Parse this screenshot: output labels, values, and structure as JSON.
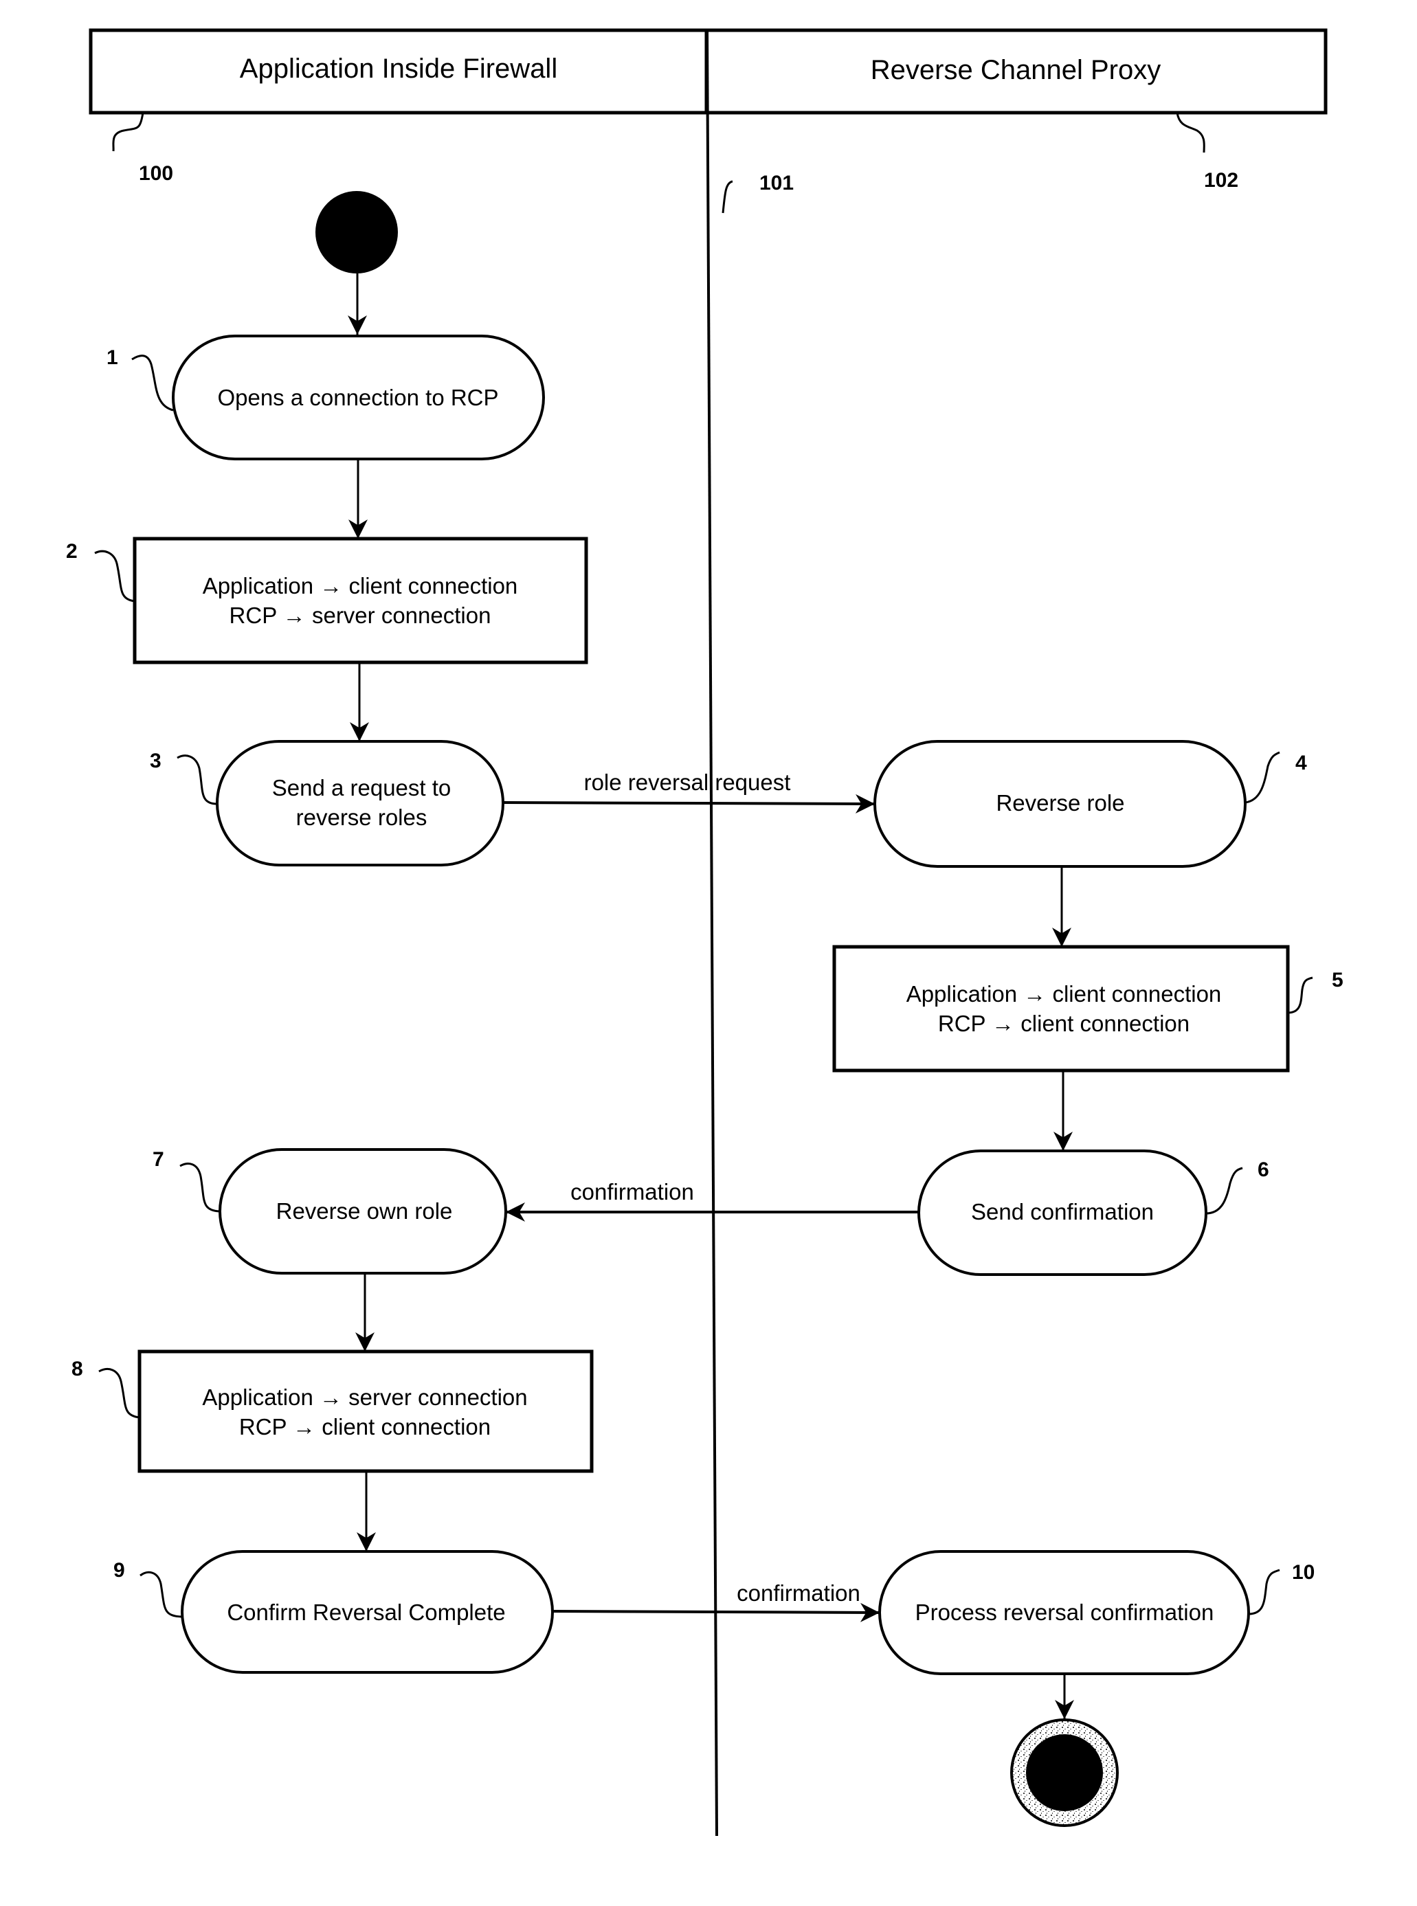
{
  "diagram": {
    "type": "uml-activity-swimlane",
    "lanes": [
      {
        "title": "Application Inside Firewall",
        "ref": "100"
      },
      {
        "title": "Reverse Channel Proxy",
        "ref": "102"
      }
    ],
    "divider_ref": "101",
    "nodes": [
      {
        "id": "1",
        "shape": "activity",
        "lane": 0,
        "lines": [
          "Opens a connection to RCP"
        ]
      },
      {
        "id": "2",
        "shape": "box",
        "lane": 0,
        "lines": [
          "Application → client connection",
          "RCP → server connection"
        ]
      },
      {
        "id": "3",
        "shape": "activity",
        "lane": 0,
        "lines": [
          "Send a request to",
          "reverse roles"
        ]
      },
      {
        "id": "4",
        "shape": "activity",
        "lane": 1,
        "lines": [
          "Reverse role"
        ]
      },
      {
        "id": "5",
        "shape": "box",
        "lane": 1,
        "lines": [
          "Application → client connection",
          "RCP → client connection"
        ]
      },
      {
        "id": "6",
        "shape": "activity",
        "lane": 1,
        "lines": [
          "Send confirmation"
        ]
      },
      {
        "id": "7",
        "shape": "activity",
        "lane": 0,
        "lines": [
          "Reverse own role"
        ]
      },
      {
        "id": "8",
        "shape": "box",
        "lane": 0,
        "lines": [
          "Application → server connection",
          "RCP → client connection"
        ]
      },
      {
        "id": "9",
        "shape": "activity",
        "lane": 0,
        "lines": [
          "Confirm Reversal Complete"
        ]
      },
      {
        "id": "10",
        "shape": "activity",
        "lane": 1,
        "lines": [
          "Process reversal confirmation"
        ]
      }
    ],
    "edges": [
      {
        "from": "start",
        "to": "1",
        "label": ""
      },
      {
        "from": "1",
        "to": "2",
        "label": ""
      },
      {
        "from": "2",
        "to": "3",
        "label": ""
      },
      {
        "from": "3",
        "to": "4",
        "label": "role reversal request"
      },
      {
        "from": "4",
        "to": "5",
        "label": ""
      },
      {
        "from": "5",
        "to": "6",
        "label": ""
      },
      {
        "from": "6",
        "to": "7",
        "label": "confirmation"
      },
      {
        "from": "7",
        "to": "8",
        "label": ""
      },
      {
        "from": "8",
        "to": "9",
        "label": ""
      },
      {
        "from": "9",
        "to": "10",
        "label": "confirmation"
      },
      {
        "from": "10",
        "to": "end",
        "label": ""
      }
    ]
  }
}
